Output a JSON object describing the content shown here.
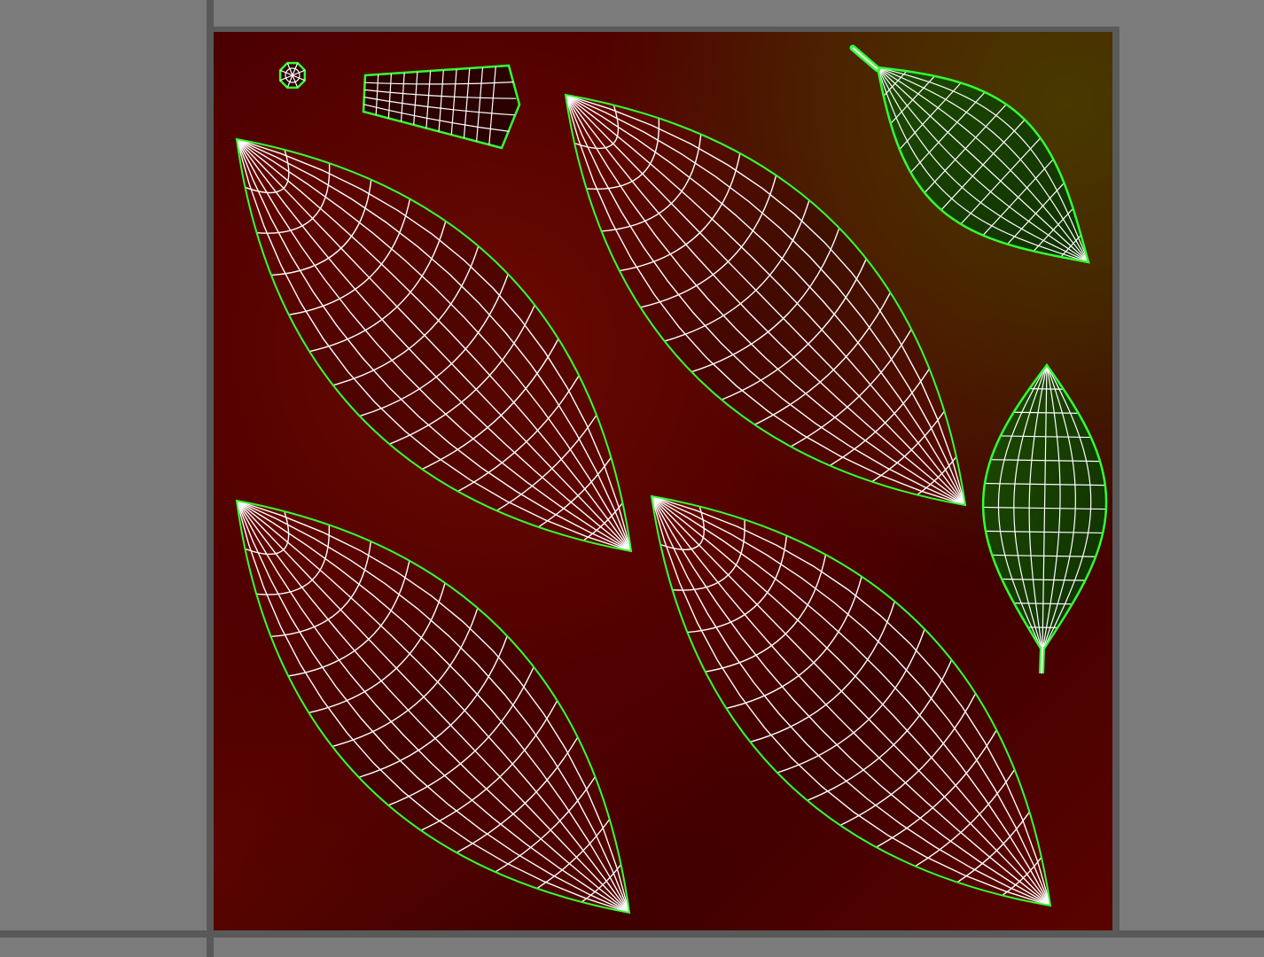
{
  "editor": {
    "view": "uv-texture-editor",
    "colors": {
      "viewport_background": "#7b7b7b",
      "grid_lines": "#595959",
      "uv_border": "#33ff33",
      "uv_wire": "#ffffff",
      "petal_fill": "#7a0a00",
      "leaf_fill": "#143d00"
    }
  },
  "uv_shells": [
    {
      "name": "petal-shell-top-left",
      "kind": "petal"
    },
    {
      "name": "petal-shell-top-center",
      "kind": "petal"
    },
    {
      "name": "petal-shell-bottom-left",
      "kind": "petal"
    },
    {
      "name": "petal-shell-bottom-center",
      "kind": "petal"
    },
    {
      "name": "leaf-shell-diagonal",
      "kind": "leaf"
    },
    {
      "name": "leaf-shell-vertical",
      "kind": "leaf"
    },
    {
      "name": "stem-shell",
      "kind": "stem"
    },
    {
      "name": "center-cap-shell",
      "kind": "cap"
    }
  ]
}
